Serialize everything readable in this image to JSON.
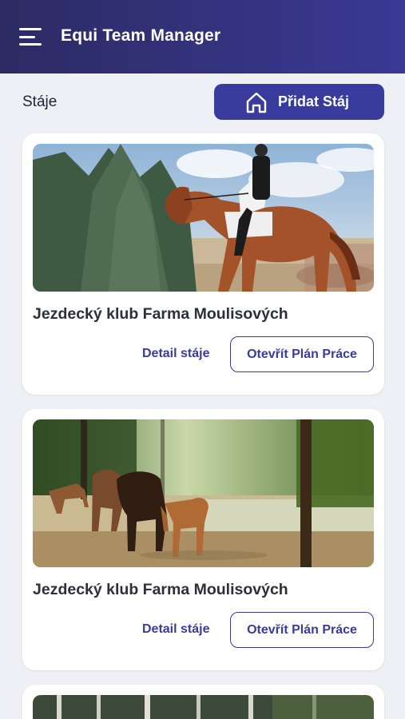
{
  "header": {
    "title": "Equi Team Manager",
    "menu_icon": "hamburger-menu-icon"
  },
  "section": {
    "title": "Stáje",
    "add_button_label": "Přidat Stáj",
    "add_button_icon": "home-icon"
  },
  "stables": [
    {
      "name": "Jezdecký klub Farma Moulisových",
      "detail_label": "Detail stáje",
      "plan_label": "Otevřít Plán Práce",
      "photo": "dressage-rider-on-chestnut-horse"
    },
    {
      "name": "Jezdecký klub Farma Moulisových",
      "detail_label": "Detail stáje",
      "plan_label": "Otevřít Plán Práce",
      "photo": "horses-grazing-in-forest-pasture"
    }
  ],
  "colors": {
    "header_gradient_start": "#2c2b63",
    "header_gradient_end": "#3a3994",
    "accent": "#393b9d",
    "background": "#eef0f5"
  }
}
